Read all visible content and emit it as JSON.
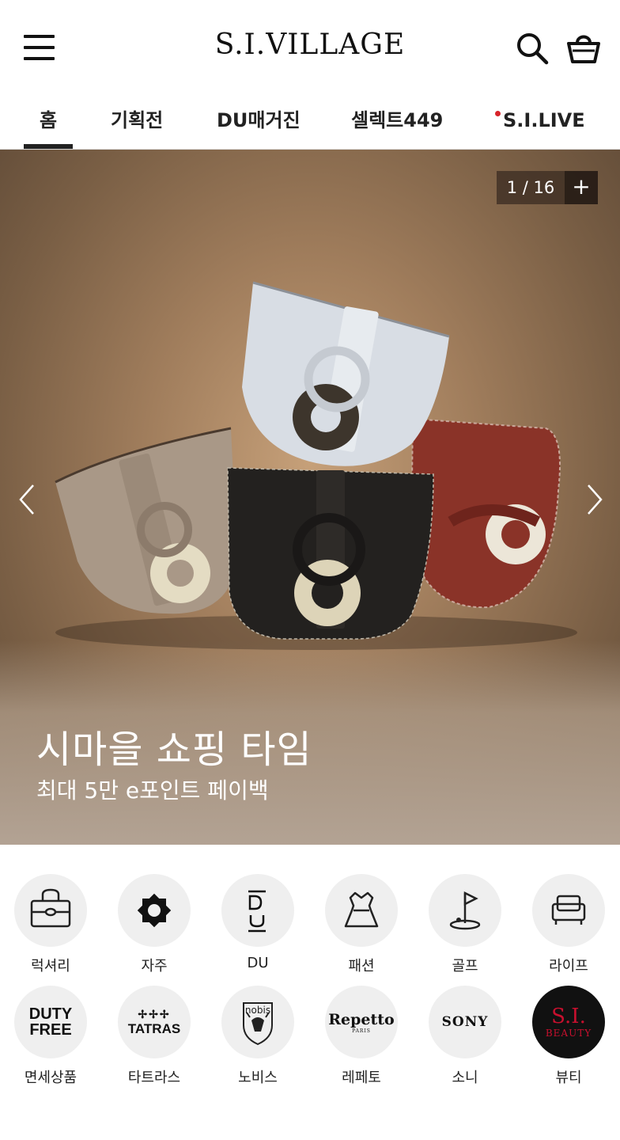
{
  "header": {
    "logo": "S.I.VILLAGE",
    "menu_icon": "hamburger-menu-icon",
    "search_icon": "search-icon",
    "cart_icon": "shopping-basket-icon"
  },
  "tabs": [
    {
      "label": "홈",
      "active": true
    },
    {
      "label": "기획전"
    },
    {
      "label": "DU매거진"
    },
    {
      "label": "셀렉트449"
    },
    {
      "label": "S.I.LIVE",
      "live_indicator_color": "#d8242a"
    }
  ],
  "hero": {
    "counter": "1 / 16",
    "expand_label": "+",
    "title": "시마을 쇼핑 타임",
    "subtitle": "최대 5만 e포인트 페이백"
  },
  "categories": [
    {
      "label": "럭셔리",
      "icon": "luxury-bag-icon"
    },
    {
      "label": "자주",
      "icon": "jaju-logo-icon"
    },
    {
      "label": "DU",
      "icon": "du-logo-icon"
    },
    {
      "label": "패션",
      "icon": "dress-icon"
    },
    {
      "label": "골프",
      "icon": "golf-flag-icon"
    },
    {
      "label": "라이프",
      "icon": "sofa-icon"
    },
    {
      "label": "면세상품",
      "icon": "duty-free-logo",
      "logo_text": [
        "DUTY",
        "FREE"
      ]
    },
    {
      "label": "타트라스",
      "icon": "tatras-logo",
      "logo_text": "TATRAS"
    },
    {
      "label": "노비스",
      "icon": "nobis-logo",
      "logo_text": "nobis"
    },
    {
      "label": "레페토",
      "icon": "repetto-logo",
      "logo_text": "Repetto",
      "logo_sub": "PARIS"
    },
    {
      "label": "소니",
      "icon": "sony-logo",
      "logo_text": "SONY"
    },
    {
      "label": "뷰티",
      "icon": "si-beauty-logo",
      "logo_text": "S.I.",
      "logo_sub": "BEAUTY",
      "accent": "#c8102e"
    }
  ]
}
